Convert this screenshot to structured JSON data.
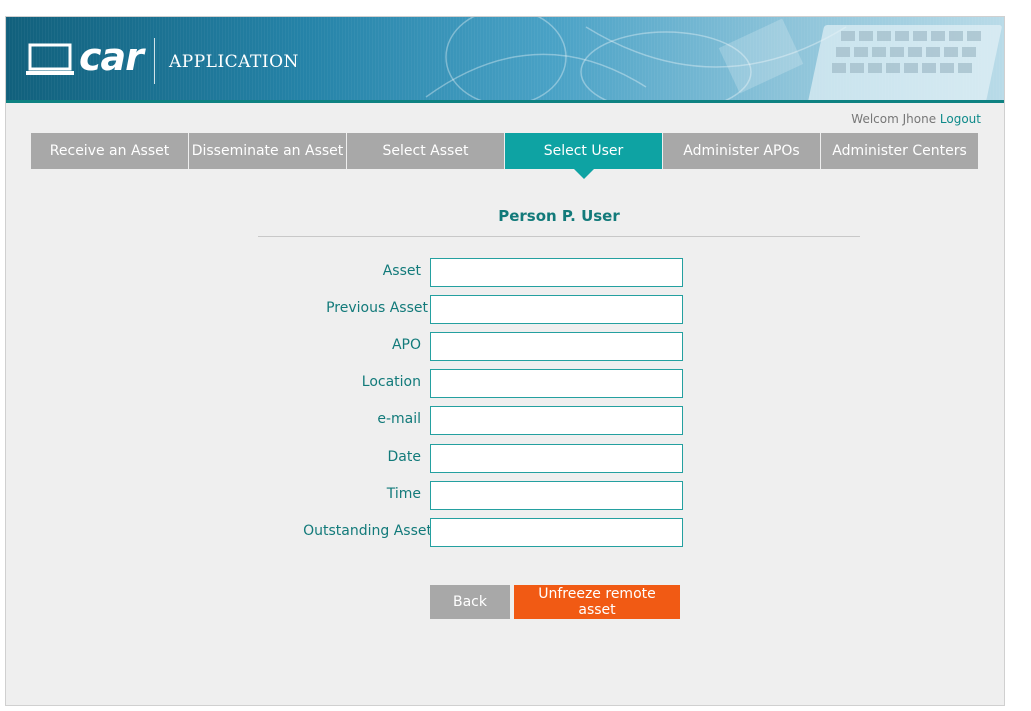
{
  "header": {
    "logo_text": "car",
    "app_title": "APPLICATION"
  },
  "user_bar": {
    "welcome_text": "Welcom Jhone",
    "logout_label": "Logout"
  },
  "nav": {
    "items": [
      {
        "label": "Receive an Asset"
      },
      {
        "label": "Disseminate an Asset"
      },
      {
        "label": "Select Asset"
      },
      {
        "label": "Select User",
        "active": true
      },
      {
        "label": "Administer APOs"
      },
      {
        "label": "Administer Centers"
      }
    ]
  },
  "form": {
    "person_name": "Person P. User",
    "fields": [
      {
        "label": "Asset",
        "value": ""
      },
      {
        "label": "Previous Asset",
        "value": ""
      },
      {
        "label": "APO",
        "value": ""
      },
      {
        "label": "Location",
        "value": ""
      },
      {
        "label": "e-mail",
        "value": ""
      },
      {
        "label": "Date",
        "value": ""
      },
      {
        "label": "Time",
        "value": ""
      },
      {
        "label": "Outstanding Asset",
        "value": ""
      }
    ]
  },
  "buttons": {
    "back_label": "Back",
    "unfreeze_label": "Unfreeze remote asset"
  },
  "colors": {
    "accent": "#0ea3a3",
    "nav_inactive": "#a8a8a8",
    "action": "#f15a14",
    "label_text": "#127a7a"
  },
  "icons": {
    "logo": "laptop-icon"
  }
}
